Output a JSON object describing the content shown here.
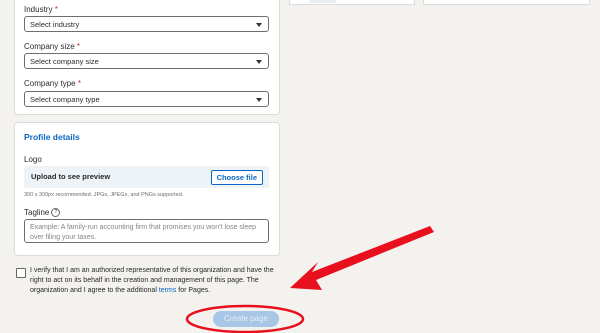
{
  "form": {
    "industry": {
      "label": "Industry",
      "required_mark": "*",
      "value": "Select industry"
    },
    "company_size": {
      "label": "Company size",
      "required_mark": "*",
      "value": "Select company size"
    },
    "company_type": {
      "label": "Company type",
      "required_mark": "*",
      "value": "Select company type"
    }
  },
  "profile": {
    "title": "Profile details",
    "logo_label": "Logo",
    "upload_text": "Upload to see preview",
    "choose_file": "Choose file",
    "hint": "300 x 300px recommended. JPGs, JPEGs, and PNGs supported.",
    "tagline_label": "Tagline",
    "tagline_placeholder": "Example: A family-run accounting firm that promises you won’t lose sleep over filing your taxes."
  },
  "verify": {
    "text_before": "I verify that I am an authorized representative of this organization and have the right to act on its behalf in the creation and management of this page. The organization and I agree to the additional ",
    "terms_link": "terms",
    "text_after": " for Pages."
  },
  "create_button": "Create page",
  "colors": {
    "accent": "#0a66c2",
    "annotation": "#e8101c",
    "disabled_button": "#a8c6e5"
  }
}
